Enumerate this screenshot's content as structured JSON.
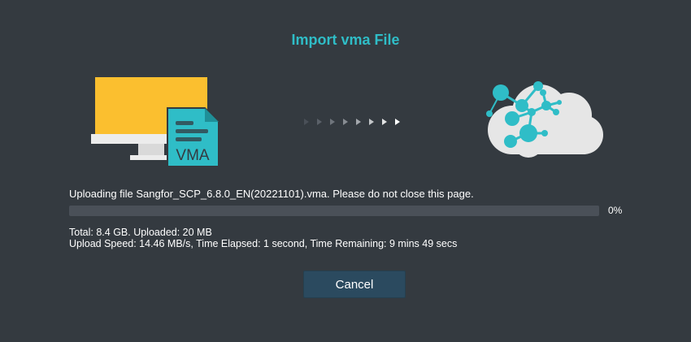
{
  "dialog": {
    "title": "Import vma File"
  },
  "illustration": {
    "file_badge": "VMA",
    "source_icon": "computer-with-vma-file-icon",
    "transfer_icon": "transfer-arrows-icon",
    "target_icon": "cloud-network-icon"
  },
  "upload": {
    "status": "Uploading file Sangfor_SCP_6.8.0_EN(20221101).vma. Please do not close this page.",
    "progress": 0,
    "progress_label": "0%",
    "total_line": "Total: 8.4 GB. Uploaded: 20 MB",
    "speed_line": "Upload Speed: 14.46 MB/s, Time Elapsed: 1 second, Time Remaining: 9 mins 49 secs"
  },
  "actions": {
    "cancel_label": "Cancel"
  },
  "colors": {
    "background": "#343a40",
    "accent": "#2fbdc7",
    "monitor_screen": "#fbbf2f",
    "button": "#2b4a5f"
  }
}
